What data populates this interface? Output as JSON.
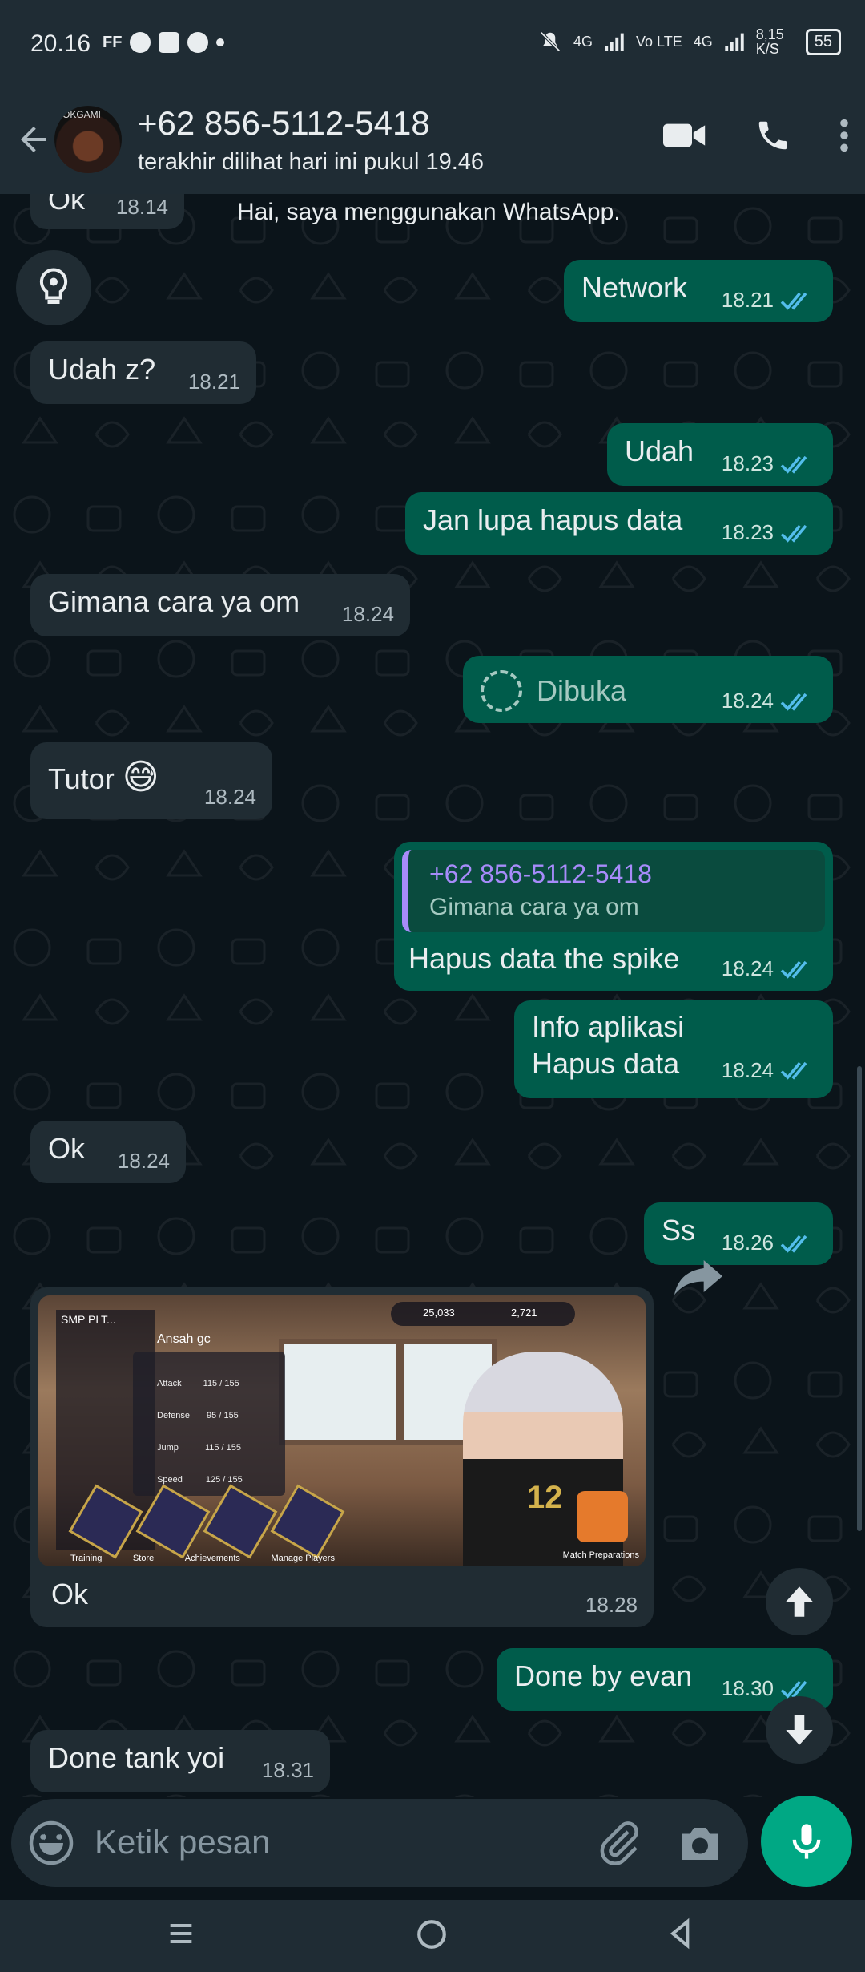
{
  "status_bar": {
    "time": "20.16",
    "ff_label": "FF",
    "network_1": "4G",
    "volte": "Vo LTE",
    "network_2": "4G",
    "speed": "8,15 K/S",
    "battery": "55"
  },
  "header": {
    "avatar_tag": "OKGAMI",
    "contact_name": "+62 856-5112-5418",
    "last_seen": "terakhir dilihat hari ini pukul 19.46"
  },
  "chat": {
    "system_text": "Hai, saya menggunakan WhatsApp.",
    "messages": [
      {
        "dir": "in",
        "text": "Ok",
        "time": "18.14"
      },
      {
        "dir": "out",
        "text": "Network",
        "time": "18.21"
      },
      {
        "dir": "in",
        "text": "Udah z?",
        "time": "18.21"
      },
      {
        "dir": "out",
        "text": "Udah",
        "time": "18.23"
      },
      {
        "dir": "out",
        "text": "Jan lupa hapus data",
        "time": "18.23"
      },
      {
        "dir": "in",
        "text": "Gimana cara ya om",
        "time": "18.24"
      },
      {
        "dir": "out",
        "text": "Dibuka",
        "time": "18.24"
      },
      {
        "dir": "in",
        "text": "Tutor",
        "emoji": "😅",
        "time": "18.24"
      },
      {
        "dir": "out",
        "reply_name": "+62 856-5112-5418",
        "reply_text": "Gimana cara ya om",
        "text": "Hapus data the spike",
        "time": "18.24"
      },
      {
        "dir": "out",
        "text_line1": "Info aplikasi",
        "text_line2": "Hapus data",
        "time": "18.24"
      },
      {
        "dir": "in",
        "text": "Ok",
        "time": "18.24"
      },
      {
        "dir": "out",
        "text": "Ss",
        "time": "18.26"
      },
      {
        "dir": "in",
        "image": true,
        "caption": "Ok",
        "time": "18.28"
      },
      {
        "dir": "out",
        "text": "Done by evan",
        "time": "18.30"
      },
      {
        "dir": "in",
        "text": "Done tank yoi",
        "time": "18.31"
      }
    ]
  },
  "game_screenshot": {
    "school_label": "SMP PLT...",
    "player_name": "Ansah gc",
    "coins": "25,033",
    "gems": "2,721",
    "jersey_number": "12",
    "stats": [
      "Attack",
      "Defense",
      "Jump",
      "Speed"
    ],
    "stat_values": [
      "115 / 155",
      "95 / 155",
      "115 / 155",
      "125 / 155"
    ],
    "menu": [
      "Training",
      "Store",
      "Achievements",
      "Manage Players",
      "Match Preparations"
    ]
  },
  "composer": {
    "placeholder": "Ketik pesan"
  },
  "colors": {
    "outgoing": "#005c4b",
    "incoming": "#202c33",
    "accent": "#00a884",
    "tick_read": "#53bdeb"
  }
}
